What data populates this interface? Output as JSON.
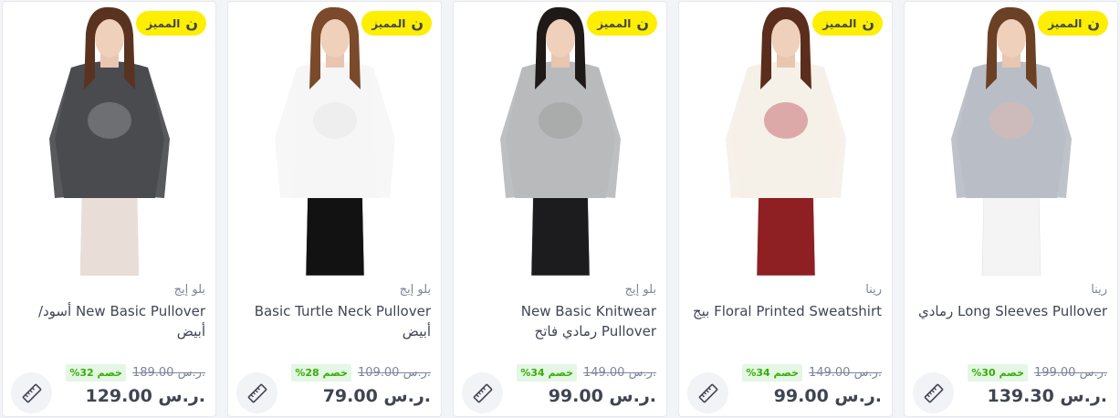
{
  "badge_label": "المميز",
  "badge_symbol": "ن",
  "colors": {
    "badge": "#feee00",
    "discount_text": "#38ae04",
    "discount_bg": "#e3f7e4",
    "text": "#404553",
    "muted": "#7e859b"
  },
  "products": [
    {
      "brand": "رينا",
      "title": "Long Sleeves Pullover رمادي",
      "old_price": "199.00 ر.س.",
      "discount": "خصم 30%",
      "price": "139.30 ر.س.",
      "colors": {
        "top": "#b9bec6",
        "top_pattern": "#e6b9ad",
        "bottom": "#f4f4f4",
        "hair": "#6b4126"
      }
    },
    {
      "brand": "رينا",
      "title": "Floral Printed Sweatshirt بيج",
      "old_price": "149.00 ر.س.",
      "discount": "خصم 34%",
      "price": "99.00 ر.س.",
      "colors": {
        "top": "#f5f0e8",
        "top_pattern": "#c2525a",
        "bottom": "#8e1f22",
        "hair": "#5a2d1c"
      }
    },
    {
      "brand": "بلو إيج",
      "title": "New Basic Knitwear Pullover رمادي فاتح",
      "old_price": "149.00 ر.س.",
      "discount": "خصم 34%",
      "price": "99.00 ر.س.",
      "colors": {
        "top": "#b9babb",
        "top_pattern": "#9a9b9c",
        "bottom": "#1c1c1f",
        "hair": "#1f1a17"
      }
    },
    {
      "brand": "بلو إيج",
      "title": "Basic Turtle Neck Pullover أبيض",
      "old_price": "109.00 ر.س.",
      "discount": "خصم 28%",
      "price": "79.00 ر.س.",
      "colors": {
        "top": "#f6f6f6",
        "top_pattern": "#e4e4e4",
        "bottom": "#121212",
        "hair": "#7a4a2a"
      }
    },
    {
      "brand": "بلو إيج",
      "title": "New Basic Pullover أسود/أبيض",
      "old_price": "189.00 ر.س.",
      "discount": "خصم 32%",
      "price": "129.00 ر.س.",
      "colors": {
        "top": "#4a4b4f",
        "top_pattern": "#9a9ba0",
        "bottom": "#e9ddd7",
        "hair": "#5a3320"
      }
    }
  ]
}
